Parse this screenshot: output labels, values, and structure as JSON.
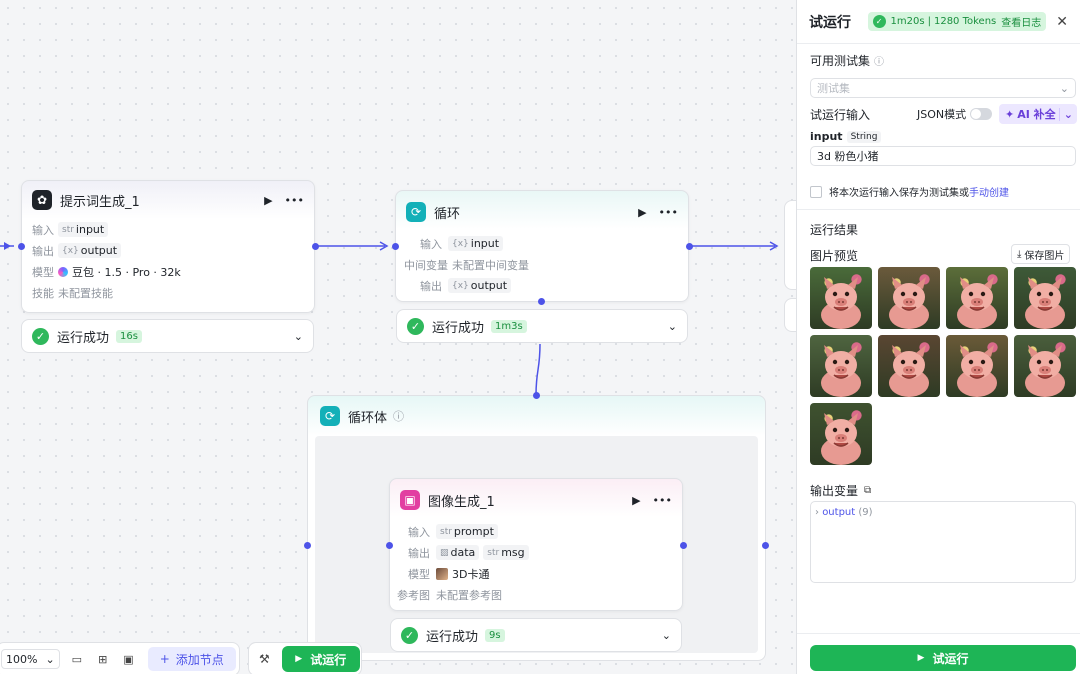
{
  "canvas": {
    "node_prompt": {
      "title": "提示词生成_1",
      "input_label": "输入",
      "input_type": "str",
      "input_var": "input",
      "output_label": "输出",
      "output_type": "{x}",
      "output_var": "output",
      "model_label": "模型",
      "model_value": "豆包 · 1.5 · Pro · 32k",
      "skill_label": "技能",
      "skill_value": "未配置技能",
      "status_text": "运行成功",
      "status_time": "16s"
    },
    "node_loop": {
      "title": "循环",
      "input_label": "输入",
      "input_type": "{x}",
      "input_var": "input",
      "mid_label": "中间变量",
      "mid_value": "未配置中间变量",
      "output_label": "输出",
      "output_type": "{x}",
      "output_var": "output",
      "status_text": "运行成功",
      "status_time": "1m3s"
    },
    "loop_body": {
      "title": "循环体"
    },
    "node_image": {
      "title": "图像生成_1",
      "input_label": "输入",
      "input_type": "str",
      "input_var": "prompt",
      "output_label": "输出",
      "output_var1": "data",
      "output_type2": "str",
      "output_var2": "msg",
      "model_label": "模型",
      "model_value": "3D卡通",
      "ref_label": "参考图",
      "ref_value": "未配置参考图",
      "status_text": "运行成功",
      "status_time": "9s"
    }
  },
  "toolbar": {
    "zoom": "100%",
    "add_node": "添加节点",
    "test_run": "试运行"
  },
  "panel": {
    "title": "试运行",
    "summary_time": "1m20s",
    "summary_tokens": "1280 Tokens",
    "view_log": "查看日志",
    "testset_label": "可用测试集",
    "testset_placeholder": "测试集",
    "run_input_label": "试运行输入",
    "json_mode": "JSON模式",
    "ai_fill": "AI 补全",
    "input_name": "input",
    "input_type": "String",
    "input_value": "3d 粉色小猪",
    "save_prefix": "将本次运行输入保存为测试集或",
    "save_link": "手动创建",
    "result_label": "运行结果",
    "preview_label": "图片预览",
    "save_images": "保存图片",
    "output_var_label": "输出变量",
    "output_tree_name": "output",
    "output_tree_count": "(9)",
    "run_button": "试运行"
  }
}
